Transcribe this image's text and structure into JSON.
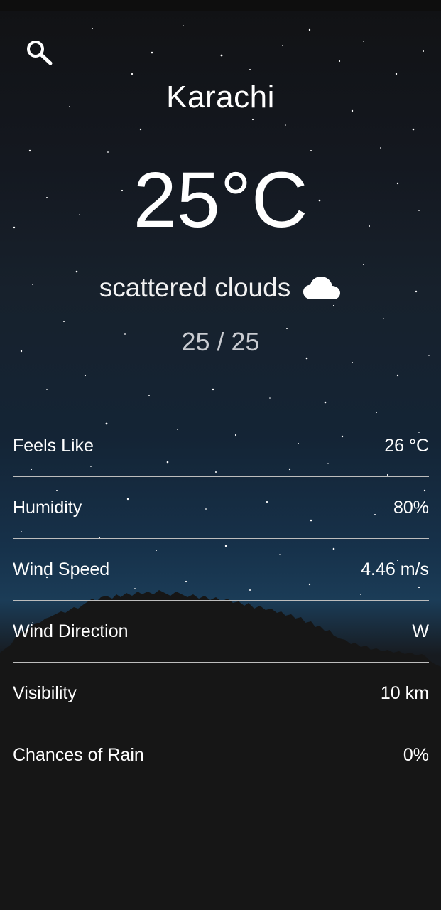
{
  "header": {
    "search_icon": "search-icon"
  },
  "weather": {
    "city": "Karachi",
    "temperature": "25°C",
    "condition": "scattered clouds",
    "condition_icon": "cloud-icon",
    "min_max": "25 / 25"
  },
  "details": [
    {
      "label": "Feels Like",
      "value": "26 °C"
    },
    {
      "label": "Humidity",
      "value": "80%"
    },
    {
      "label": "Wind Speed",
      "value": "4.46 m/s"
    },
    {
      "label": "Wind Direction",
      "value": "W"
    },
    {
      "label": "Visibility",
      "value": "10 km"
    },
    {
      "label": "Chances of Rain",
      "value": "0%"
    }
  ]
}
